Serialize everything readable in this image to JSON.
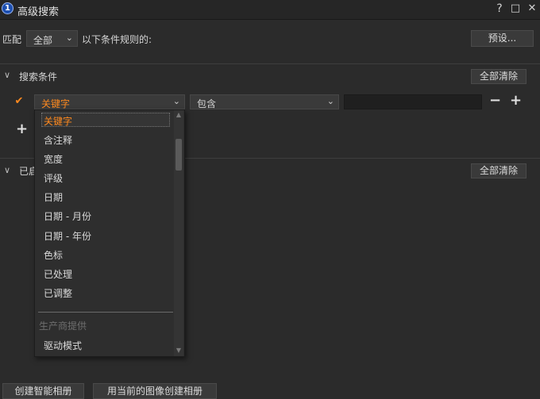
{
  "window": {
    "title": "高级搜索",
    "app_icon_glyph": "1",
    "help": "?",
    "maximize": "□",
    "close": "✕"
  },
  "match": {
    "prefix": "匹配",
    "value": "全部",
    "suffix": "以下条件规则的:",
    "preset_button": "预设..."
  },
  "search_section": {
    "title": "搜索条件",
    "clear_all": "全部清除"
  },
  "condition": {
    "checked_glyph": "✔",
    "field": "关键字",
    "operator": "包含",
    "value": "",
    "remove": "−",
    "add": "+"
  },
  "add_condition": "+",
  "second_section": {
    "title_visible": "已启",
    "clear_all": "全部清除"
  },
  "dropdown": {
    "items": [
      "关键字",
      "含注释",
      "宽度",
      "评级",
      "日期",
      "日期 - 月份",
      "日期 - 年份",
      "色标",
      "已处理",
      "已调整"
    ],
    "group_label": "生产商提供",
    "group_items": [
      "驱动模式"
    ]
  },
  "footer": {
    "create_smart_album": "创建智能相册",
    "create_from_current": "用当前的图像创建相册"
  },
  "colors": {
    "accent": "#ff8a1f",
    "background": "#2b2b2b"
  }
}
